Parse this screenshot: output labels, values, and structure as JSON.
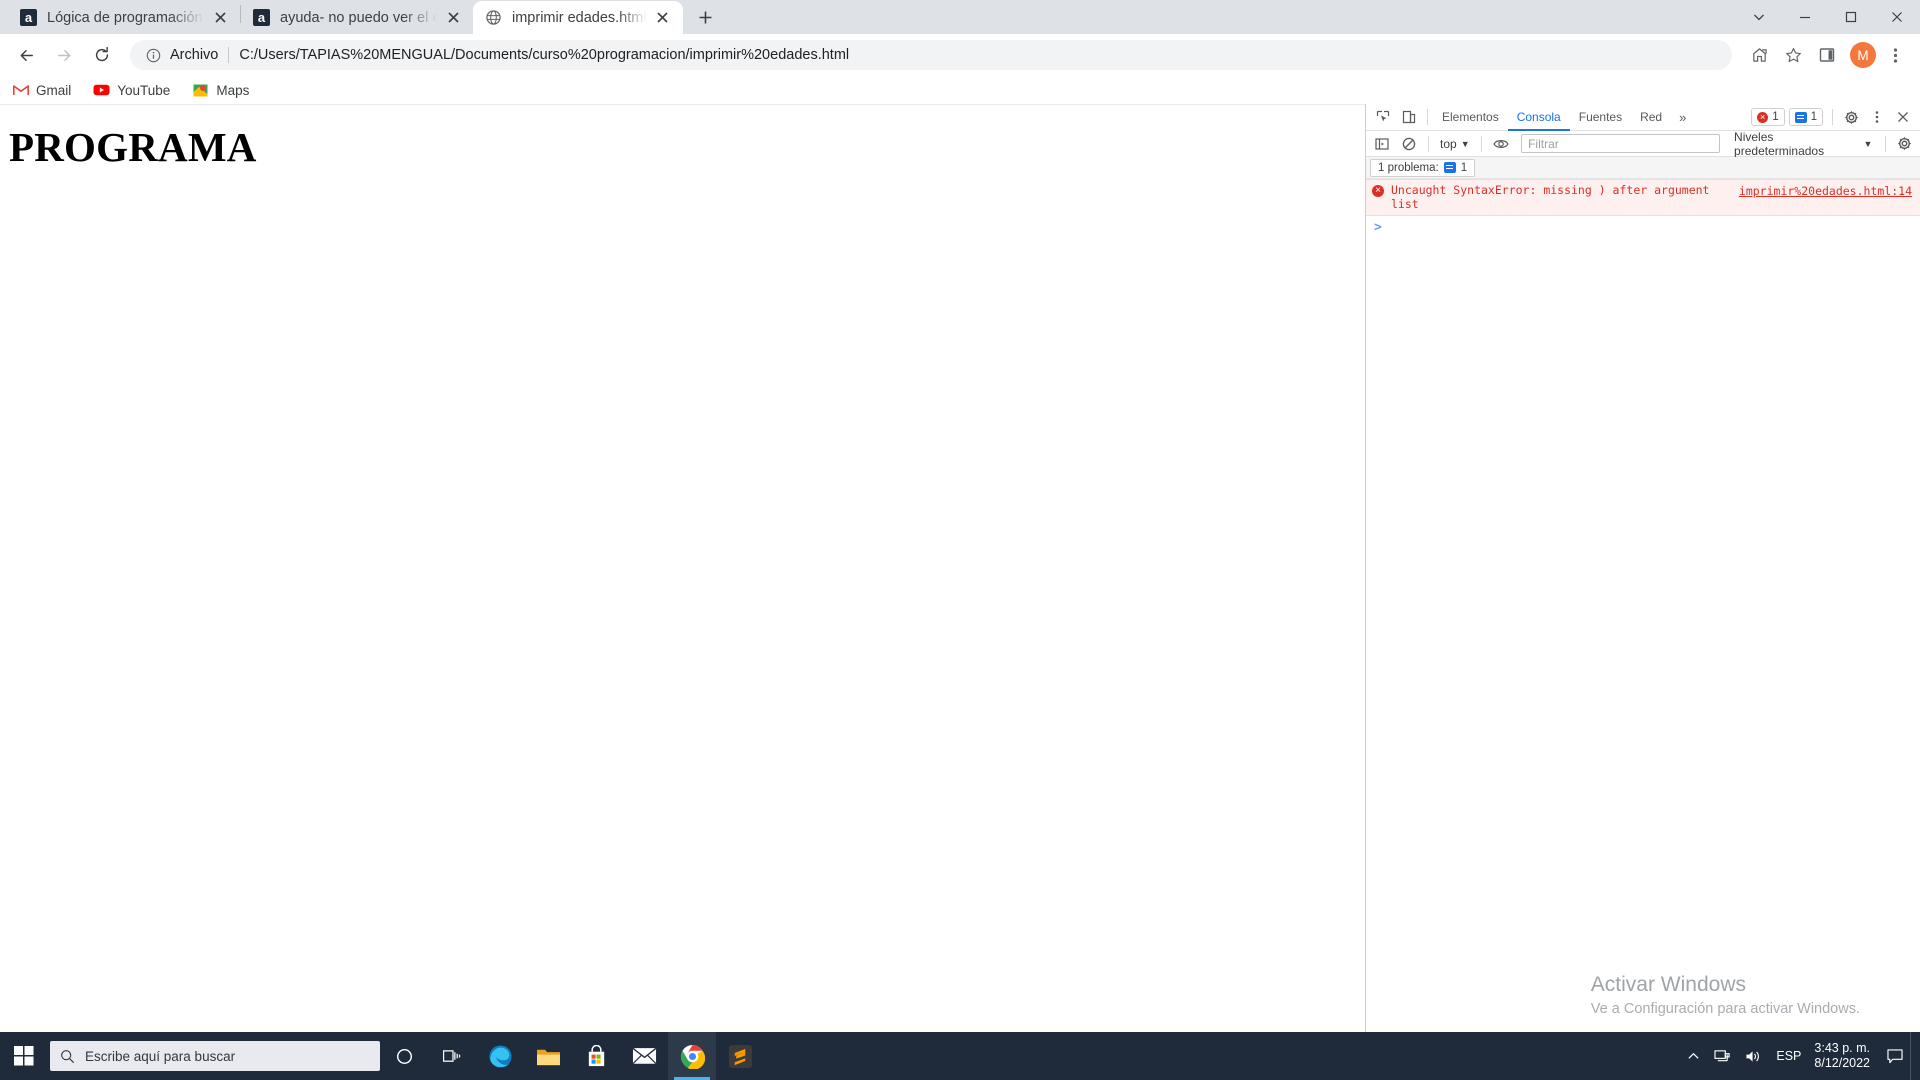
{
  "browser": {
    "tabs": [
      {
        "title": "Lógica de programación: Primero",
        "favicon": "alura-a-icon",
        "active": false
      },
      {
        "title": "ayuda- no puedo ver el error de r",
        "favicon": "alura-a-icon",
        "active": false
      },
      {
        "title": "imprimir edades.html",
        "favicon": "local-file-globe-icon",
        "active": true
      }
    ],
    "new_tab_label": "+",
    "window_controls": {
      "minimize": "minimize-icon",
      "maximize": "maximize-icon",
      "close": "close-icon",
      "chevron": "chevron-down-icon"
    },
    "toolbar": {
      "back": "back-arrow-icon",
      "forward": "forward-arrow-icon",
      "reload": "reload-icon",
      "omnibox_scheme": "Archivo",
      "omnibox_url": "C:/Users/TAPIAS%20MENGUAL/Documents/curso%20programacion/imprimir%20edades.html",
      "share": "share-icon",
      "bookmark": "star-icon",
      "side_panel": "side-panel-icon",
      "avatar_letter": "M",
      "menu": "three-dot-menu-icon"
    },
    "bookmarks": [
      {
        "label": "Gmail",
        "icon": "gmail-icon"
      },
      {
        "label": "YouTube",
        "icon": "youtube-icon"
      },
      {
        "label": "Maps",
        "icon": "maps-icon"
      }
    ]
  },
  "page": {
    "heading": "PROGRAMA"
  },
  "devtools": {
    "inspect_icon": "inspect-element-icon",
    "device_icon": "device-toolbar-icon",
    "tabs": [
      {
        "label": "Elementos",
        "active": false
      },
      {
        "label": "Consola",
        "active": true
      },
      {
        "label": "Fuentes",
        "active": false
      },
      {
        "label": "Red",
        "active": false
      }
    ],
    "more_tabs": "»",
    "error_badge_count": "1",
    "info_badge_count": "1",
    "settings_icon": "gear-icon",
    "menu_icon": "three-dot-menu-icon",
    "close_icon": "close-icon",
    "console_toolbar": {
      "sidebar_toggle": "console-sidebar-icon",
      "clear": "clear-console-icon",
      "context": "top",
      "context_caret": "▼",
      "eye": "live-expression-icon",
      "filter_placeholder": "Filtrar",
      "levels": "Niveles predeterminados",
      "levels_caret": "▼",
      "gear": "console-settings-icon"
    },
    "issues_bar": {
      "text": "1 problema:",
      "count": "1"
    },
    "messages": [
      {
        "level": "error",
        "text": "Uncaught SyntaxError: missing ) after argument list",
        "source": "imprimir%20edades.html:14"
      }
    ],
    "prompt": ">"
  },
  "watermark": {
    "title": "Activar Windows",
    "subtitle": "Ve a Configuración para activar Windows."
  },
  "taskbar": {
    "start": "windows-start-icon",
    "search_placeholder": "Escribe aquí para buscar",
    "search_icon": "search-icon",
    "apps": [
      {
        "name": "cortana-icon",
        "active": false
      },
      {
        "name": "task-view-icon",
        "active": false
      },
      {
        "name": "microsoft-edge-icon",
        "active": false
      },
      {
        "name": "file-explorer-icon",
        "active": false
      },
      {
        "name": "microsoft-store-icon",
        "active": false
      },
      {
        "name": "mail-icon",
        "active": false
      },
      {
        "name": "google-chrome-icon",
        "active": true
      },
      {
        "name": "sublime-text-icon",
        "active": false
      }
    ],
    "tray": {
      "chevron": "show-hidden-icons-icon",
      "network": "network-icon",
      "volume": "volume-icon",
      "language": "ESP",
      "time": "3:43 p. m.",
      "date": "8/12/2022",
      "notifications": "action-center-icon"
    }
  }
}
